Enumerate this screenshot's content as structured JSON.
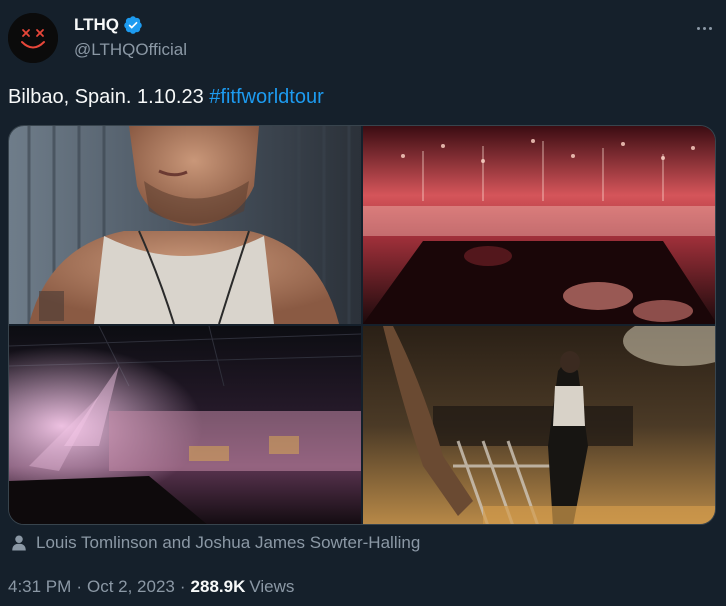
{
  "author": {
    "display_name": "LTHQ",
    "handle": "@LTHQOfficial",
    "verified_icon": "verified-badge-icon",
    "avatar_icon": "smiley-face-logo"
  },
  "tweet": {
    "text": "Bilbao, Spain. 1.10.23 ",
    "hashtag": "#fitfworldtour"
  },
  "media": {
    "photos": [
      "portrait-photo",
      "concert-fireworks-photo",
      "arena-crowd-photo",
      "stage-back-view-photo"
    ]
  },
  "tagged": {
    "icon": "person-icon",
    "text": "Louis Tomlinson and Joshua James Sowter-Halling"
  },
  "meta": {
    "time": "4:31 PM",
    "separator": "·",
    "date": "Oct 2, 2023",
    "views_count": "288.9K",
    "views_label": "Views"
  },
  "colors": {
    "background": "#15202b",
    "accent": "#1d9bf0",
    "muted": "#8b98a5",
    "text": "#f7f9f9"
  }
}
